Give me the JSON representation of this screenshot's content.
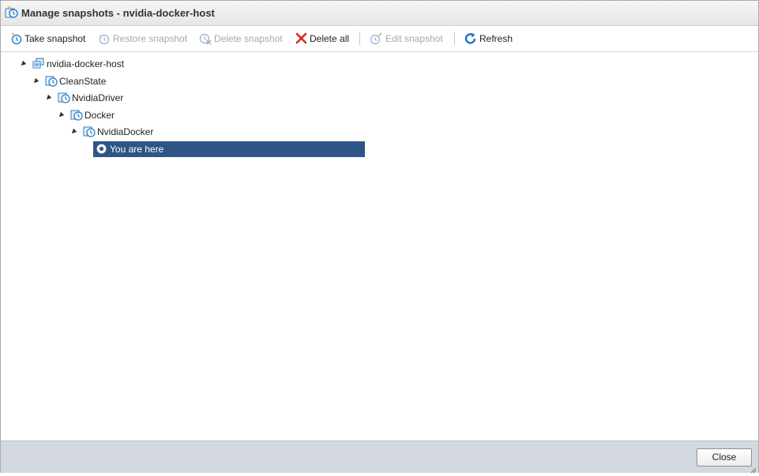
{
  "window": {
    "title": "Manage snapshots - nvidia-docker-host",
    "icon": "snapshot-manager-icon"
  },
  "toolbar": {
    "take_snapshot": {
      "label": "Take snapshot",
      "icon": "take-snapshot-icon",
      "enabled": true
    },
    "restore_snapshot": {
      "label": "Restore snapshot",
      "icon": "restore-snapshot-icon",
      "enabled": false
    },
    "delete_snapshot": {
      "label": "Delete snapshot",
      "icon": "delete-snapshot-icon",
      "enabled": false
    },
    "delete_all": {
      "label": "Delete all",
      "icon": "red-x-icon",
      "enabled": true
    },
    "edit_snapshot": {
      "label": "Edit snapshot",
      "icon": "edit-snapshot-icon",
      "enabled": false
    },
    "refresh": {
      "label": "Refresh",
      "icon": "refresh-icon",
      "enabled": true
    }
  },
  "tree": {
    "nodes": [
      {
        "label": "nvidia-docker-host",
        "icon": "vm-icon",
        "depth": 0,
        "expanded": true
      },
      {
        "label": "CleanState",
        "icon": "snapshot-icon",
        "depth": 1,
        "expanded": true
      },
      {
        "label": "NvidiaDriver",
        "icon": "snapshot-icon",
        "depth": 2,
        "expanded": true
      },
      {
        "label": "Docker",
        "icon": "snapshot-icon",
        "depth": 3,
        "expanded": true
      },
      {
        "label": "NvidiaDocker",
        "icon": "snapshot-icon",
        "depth": 4,
        "expanded": true
      }
    ],
    "current": {
      "label": "You are here",
      "icon": "radio-current-icon",
      "depth": 5,
      "selected": true
    }
  },
  "footer": {
    "close_label": "Close"
  },
  "colors": {
    "selection": "#2d5585",
    "footer_bg": "#d4d9e0",
    "icon_blue": "#2b7bc4",
    "delete_red": "#d52b1e"
  }
}
